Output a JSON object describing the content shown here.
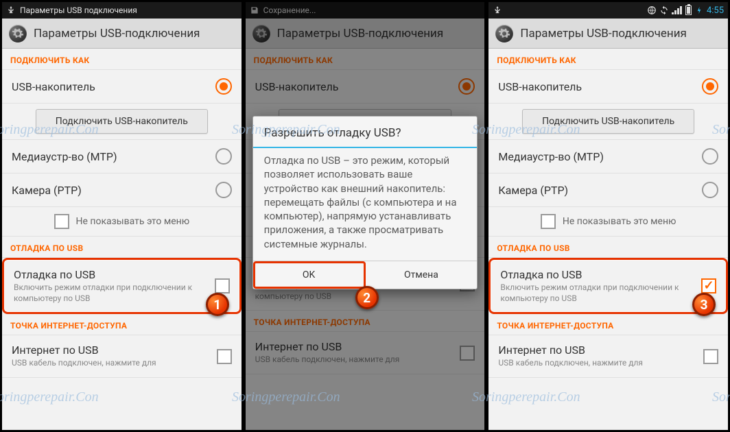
{
  "watermark": "Soringperepair.Con",
  "common": {
    "app_title": "Параметры USB-подключения",
    "section_connect": "ПОДКЛЮЧИТЬ КАК",
    "section_debug": "ОТЛАДКА ПО USB",
    "section_tether": "ТОЧКА ИНТЕРНЕТ-ДОСТУПА",
    "opt_storage": "USB-накопитель",
    "btn_connect_storage": "Подключить USB-накопитель",
    "opt_mtp": "Медиаустр-во (MTP)",
    "opt_ptp": "Камера (PTP)",
    "dont_show": "Не показывать это меню",
    "debug_title": "Отладка по USB",
    "debug_sub": "Включить режим отладки при подключении к компьютеру по USB",
    "tether_title": "Интернет по USB",
    "tether_sub": "USB кабель подключен, нажмите для"
  },
  "screen1": {
    "status_title": "Параметры USB подключения",
    "marker": "1"
  },
  "screen2": {
    "status_title": "Сохранение...",
    "marker": "2",
    "dialog": {
      "title": "Разрешить отладку USB?",
      "body": "Отладка по USB – это режим, который позволяет использовать ваше устройство как внешний накопитель: перемещать файлы (с компьютера и на компьютер), напрямую устанавливать приложения, а также просматривать системные журналы.",
      "ok": "OK",
      "cancel": "Отмена"
    }
  },
  "screen3": {
    "clock": "4:55",
    "marker": "3"
  }
}
